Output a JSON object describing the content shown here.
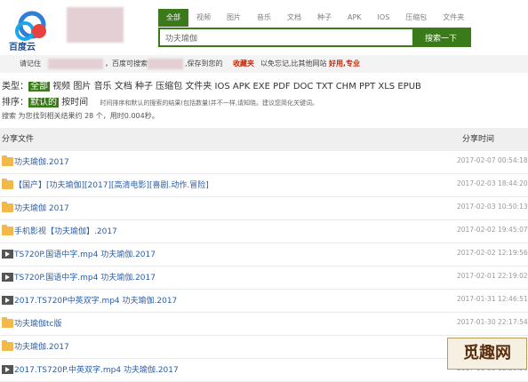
{
  "brand": {
    "logo_text": "百度云"
  },
  "tabs": [
    {
      "label": "全部",
      "active": true
    },
    {
      "label": "视频"
    },
    {
      "label": "图片"
    },
    {
      "label": "音乐"
    },
    {
      "label": "文档"
    },
    {
      "label": "种子"
    },
    {
      "label": "APK"
    },
    {
      "label": "IOS"
    },
    {
      "label": "压缩包"
    },
    {
      "label": "文件夹"
    }
  ],
  "search": {
    "value": "功夫瑜伽",
    "button_label": "搜索一下"
  },
  "notice": {
    "prefix": "请记住",
    "middle": "，百度可搜索",
    "suffix": ",保存到您的",
    "highlight1": "收藏夹",
    "suffix2": "以免忘记,比其他网站",
    "highlight2": "好用,专业"
  },
  "filters": {
    "types_label": "类型：",
    "types": [
      "全部",
      "视频",
      "图片",
      "音乐",
      "文档",
      "种子",
      "压缩包",
      "文件夹",
      "IOS",
      "APK",
      "EXE",
      "PDF",
      "DOC",
      "TXT",
      "CHM",
      "PPT",
      "XLS",
      "EPUB"
    ],
    "sort_label": "排序：",
    "sort_options": [
      "默认的",
      "按时间"
    ],
    "sort_note": "时间排序和默认的搜索的结果(包括数量)并不一样,请知晓。建议您简化关键词。",
    "stats": "搜索 为您找到相关结果约 28 个，用时0.004秒。"
  },
  "table": {
    "col_name": "分享文件",
    "col_time": "分享时间",
    "rows": [
      {
        "icon": "folder-icon",
        "name": "功夫瑜伽.2017",
        "time": "2017-02-07 00:54:18"
      },
      {
        "icon": "folder-icon",
        "name": "【国产】[功夫瑜伽][2017][高清电影][喜剧.动作.冒险]",
        "time": "2017-02-03 18:44:20"
      },
      {
        "icon": "folder-icon",
        "name": "功夫瑜伽 2017",
        "time": "2017-02-03 10:50:13"
      },
      {
        "icon": "folder-icon",
        "name": "手机影视【功夫瑜伽】.2017",
        "time": "2017-02-02 19:45:07"
      },
      {
        "icon": "video-icon",
        "name": "TS720P.国语中字.mp4 功夫瑜伽.2017",
        "time": "2017-02-02 12:19:56"
      },
      {
        "icon": "video-icon",
        "name": "TS720P.国语中字.mp4 功夫瑜伽.2017",
        "time": "2017-02-01 22:19:02"
      },
      {
        "icon": "video-icon",
        "name": "2017.TS720P中英双字.mp4 功夫瑜伽.2017",
        "time": "2017-01-31 12:46:51"
      },
      {
        "icon": "folder-icon",
        "name": "功夫瑜伽tc版",
        "time": "2017-01-30 22:17:54"
      },
      {
        "icon": "folder-icon",
        "name": "功夫瑜伽.2017",
        "time": "2017-01-30 12:29:44"
      },
      {
        "icon": "video-icon",
        "name": "2017.TS720P.中英双字.mp4 功夫瑜伽.2017",
        "time": "2017-01-30 12:29:30"
      }
    ]
  },
  "watermark": "觅趣网"
}
